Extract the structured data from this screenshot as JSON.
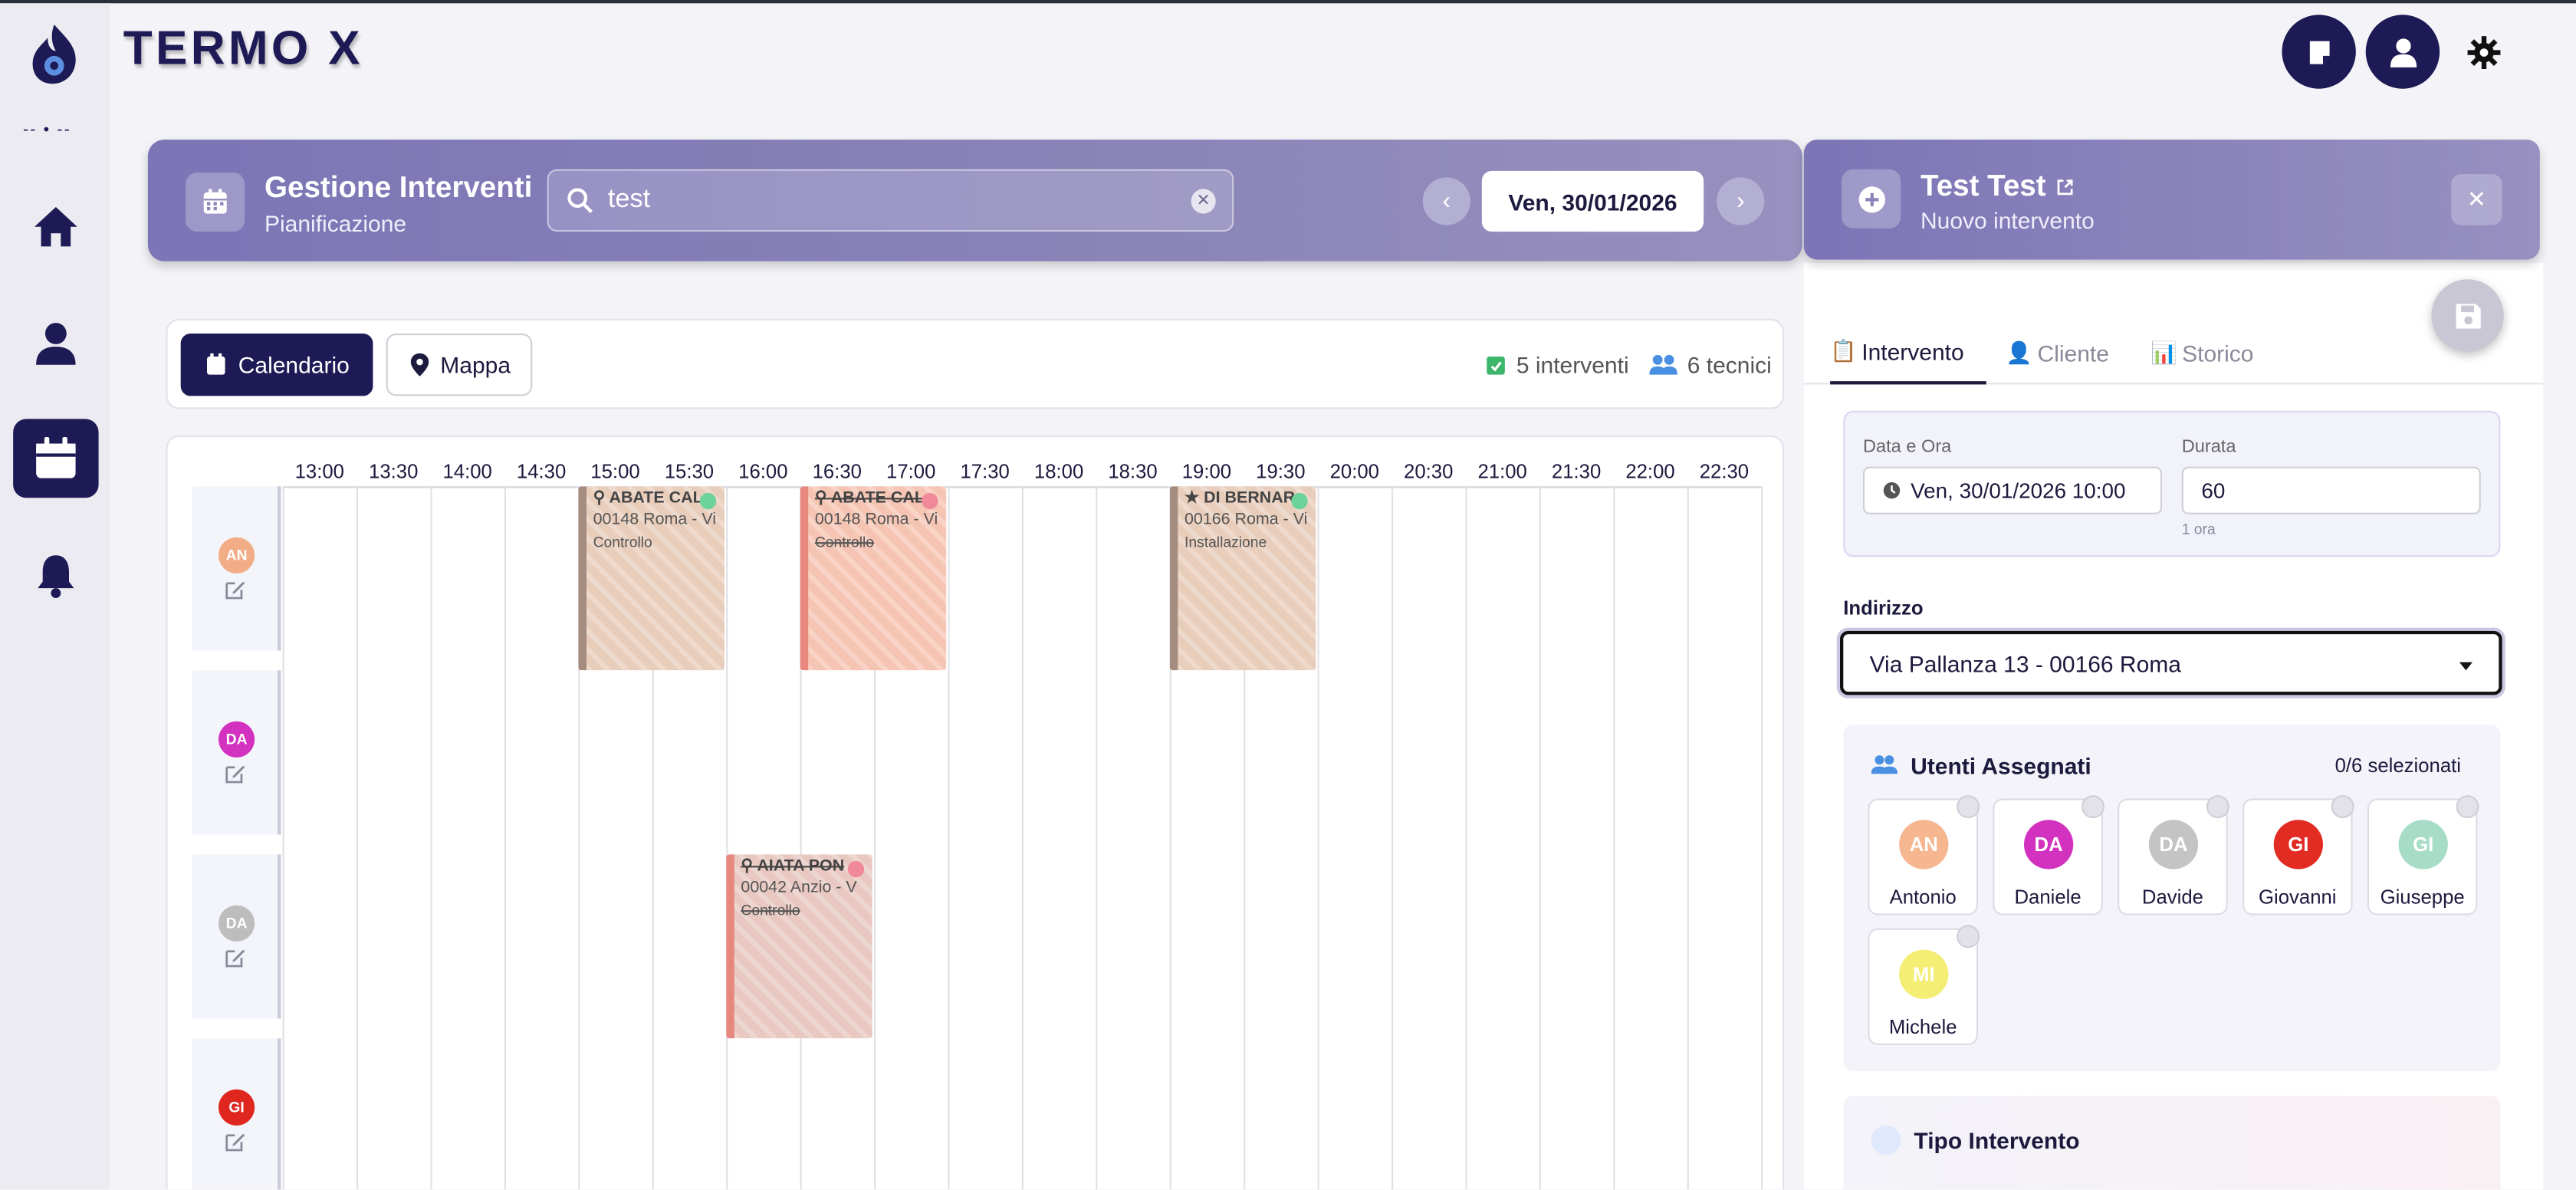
{
  "app": {
    "brand": "TERMO X",
    "brand_sub": "-- • --"
  },
  "sidebar": {
    "items": [
      {
        "name": "home",
        "icon": "home-icon",
        "active": false
      },
      {
        "name": "clienti",
        "icon": "user-icon",
        "active": false
      },
      {
        "name": "calendario",
        "icon": "calendar-icon",
        "active": true
      },
      {
        "name": "notifiche",
        "icon": "bell-icon",
        "active": false
      }
    ]
  },
  "header": {
    "buttons": [
      "note-icon",
      "user-icon"
    ],
    "theme_icon": "gear-icon"
  },
  "banner": {
    "title": "Gestione Interventi",
    "subtitle": "Pianificazione",
    "search_value": "test",
    "date": "Ven, 30/01/2026"
  },
  "viewbar": {
    "calendar_label": "Calendario",
    "map_label": "Mappa",
    "interventi": "5 interventi",
    "tecnici": "6 tecnici"
  },
  "calendar": {
    "times": [
      "13:00",
      "13:30",
      "14:00",
      "14:30",
      "15:00",
      "15:30",
      "16:00",
      "16:30",
      "17:00",
      "17:30",
      "18:00",
      "18:30",
      "19:00",
      "19:30",
      "20:00",
      "20:30",
      "21:00",
      "21:30",
      "22:00",
      "22:30"
    ],
    "rows": [
      {
        "initials": "AN",
        "color": "#f2ad86"
      },
      {
        "initials": "DA",
        "color": "#d331c0"
      },
      {
        "initials": "DA",
        "color": "#bdbdbd"
      },
      {
        "initials": "GI",
        "color": "#e0271f"
      }
    ],
    "events": [
      {
        "row": 0,
        "title": "ABATE CAL",
        "address": "00148 Roma - Vi",
        "type": "Controllo",
        "icon": "search-icon",
        "dot": "#6cd39a",
        "struck": false
      },
      {
        "row": 0,
        "title": "ABATE CAL",
        "address": "00148 Roma - Vi",
        "type": "Controllo",
        "icon": "search-icon",
        "dot": "#f08a99",
        "struck": true
      },
      {
        "row": 0,
        "title": "DI BERNAR",
        "address": "00166 Roma - Vi",
        "type": "Installazione",
        "icon": "star-icon",
        "dot": "#6cd39a",
        "struck": false
      },
      {
        "row": 2,
        "title": "AIATA PON",
        "address": "00042 Anzio - V",
        "type": "Controllo",
        "icon": "search-icon",
        "dot": "#f08a99",
        "struck": true
      }
    ]
  },
  "right_panel": {
    "title": "Test Test",
    "subtitle": "Nuovo intervento",
    "tabs": [
      {
        "label": "Intervento",
        "icon": "notepad-icon"
      },
      {
        "label": "Cliente",
        "icon": "user-icon"
      },
      {
        "label": "Storico",
        "icon": "bar-chart-icon"
      }
    ],
    "date_label": "Data e Ora",
    "date_value": "Ven, 30/01/2026 10:00",
    "duration_label": "Durata",
    "duration_value": "60",
    "duration_hint": "1 ora",
    "address_label": "Indirizzo",
    "address_value": "Via Pallanza 13 - 00166 Roma",
    "users_title": "Utenti Assegnati",
    "users_count": "0/6 selezionati",
    "users": [
      {
        "initials": "AN",
        "name": "Antonio",
        "color": "#f6b690"
      },
      {
        "initials": "DA",
        "name": "Daniele",
        "color": "#d331c0"
      },
      {
        "initials": "DA",
        "name": "Davide",
        "color": "#c4c4c4"
      },
      {
        "initials": "GI",
        "name": "Giovanni",
        "color": "#e22b22"
      },
      {
        "initials": "GI",
        "name": "Giuseppe",
        "color": "#a7dcc7"
      },
      {
        "initials": "MI",
        "name": "Michele",
        "color": "#f4ee75"
      }
    ],
    "tipo_title": "Tipo Intervento"
  }
}
